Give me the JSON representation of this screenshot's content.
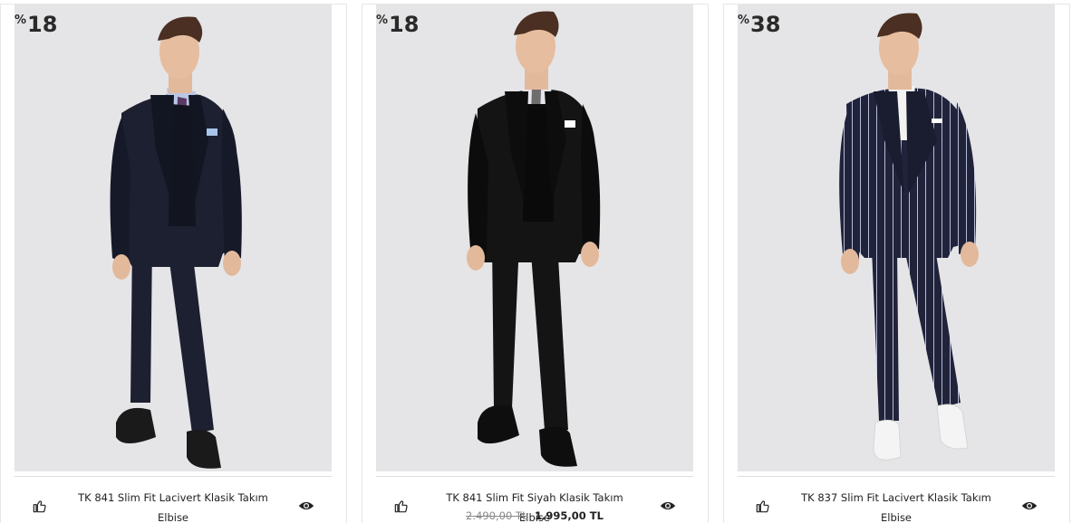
{
  "products": [
    {
      "discount_symbol": "%",
      "discount_value": "18",
      "title_line1": "TK 841 Slim Fit Lacivert Klasik Takım",
      "title_line2": "Elbise",
      "old_price": "",
      "new_price": "",
      "suit_color": "#1c2030",
      "tie_color": "#5a3a63",
      "shirt_color": "#b9c6e6",
      "shoe_color": "#1a1a1a",
      "pattern": "plain"
    },
    {
      "discount_symbol": "%",
      "discount_value": "18",
      "title_line1": "TK 841 Slim Fit Siyah Klasik Takım Elbise",
      "title_line2": "",
      "old_price": "2.490,00 TL",
      "new_price": "1.995,00 TL",
      "suit_color": "#141414",
      "tie_color": "#6e6e6e",
      "shirt_color": "#e4e4ea",
      "shoe_color": "#0e0e0e",
      "pattern": "plain"
    },
    {
      "discount_symbol": "%",
      "discount_value": "38",
      "title_line1": "TK 837 Slim Fit Lacivert Klasik Takım",
      "title_line2": "Elbise",
      "old_price": "",
      "new_price": "",
      "suit_color": "#20233a",
      "tie_color": "",
      "shirt_color": "#f2f2f2",
      "shoe_color": "#f4f4f4",
      "pattern": "pinstripe"
    }
  ],
  "icons": {
    "like": "thumbs-up-icon",
    "view": "eye-icon"
  }
}
